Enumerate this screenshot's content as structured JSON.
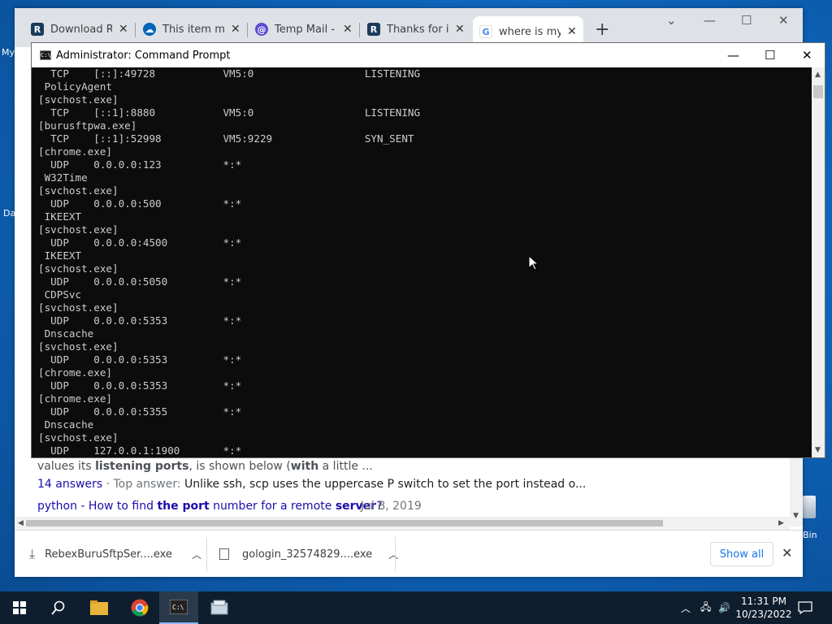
{
  "desktop": {
    "label_my": "My",
    "label_da": "Da",
    "recycle_bin_label": "Bin"
  },
  "browser": {
    "tabs": [
      {
        "title": "Download Re",
        "icon": "rebex-icon",
        "color": "#1b3a5c"
      },
      {
        "title": "This item mig",
        "icon": "onedrive-icon",
        "color": "#0364b8"
      },
      {
        "title": "Temp Mail - D",
        "icon": "tempmail-icon",
        "color": "#5b4bd4"
      },
      {
        "title": "Thanks for ins",
        "icon": "rebex-icon",
        "color": "#1b3a5c"
      },
      {
        "title": "where is my b",
        "icon": "google-icon",
        "color": "#4285f4"
      }
    ],
    "results": {
      "line1_pre": "values its ",
      "line1_bold1": "listening ports",
      "line1_mid": ", is shown below (",
      "line1_bold2": "with",
      "line1_post": " a little ...",
      "answers_link": "14 answers",
      "answers_sep": " · Top answer: ",
      "answers_text": "Unlike ssh, scp uses the uppercase P switch to set the port instead o...",
      "link_pre": "python - How to find ",
      "link_bold1": "the port",
      "link_mid": " number for a remote ",
      "link_bold2": "server",
      "link_post": "?",
      "date": "Jul 8, 2019"
    },
    "downloads": [
      {
        "name": "RebexBuruSftpSer....exe"
      },
      {
        "name": "gologin_32574829....exe"
      }
    ],
    "show_all": "Show all"
  },
  "cmd": {
    "title": "Administrator: Command Prompt",
    "icon_text": "C:\\",
    "lines": [
      "  TCP    [::]:49728           VM5:0                  LISTENING",
      " PolicyAgent",
      "[svchost.exe]",
      "  TCP    [::1]:8880           VM5:0                  LISTENING",
      "[burusftpwa.exe]",
      "  TCP    [::1]:52998          VM5:9229               SYN_SENT",
      "[chrome.exe]",
      "  UDP    0.0.0.0:123          *:*",
      " W32Time",
      "[svchost.exe]",
      "  UDP    0.0.0.0:500          *:*",
      " IKEEXT",
      "[svchost.exe]",
      "  UDP    0.0.0.0:4500         *:*",
      " IKEEXT",
      "[svchost.exe]",
      "  UDP    0.0.0.0:5050         *:*",
      " CDPSvc",
      "[svchost.exe]",
      "  UDP    0.0.0.0:5353         *:*",
      " Dnscache",
      "[svchost.exe]",
      "  UDP    0.0.0.0:5353         *:*",
      "[chrome.exe]",
      "  UDP    0.0.0.0:5353         *:*",
      "[chrome.exe]",
      "  UDP    0.0.0.0:5355         *:*",
      " Dnscache",
      "[svchost.exe]",
      "  UDP    127.0.0.1:1900       *:*"
    ]
  },
  "taskbar": {
    "time": "11:31 PM",
    "date": "10/23/2022"
  }
}
